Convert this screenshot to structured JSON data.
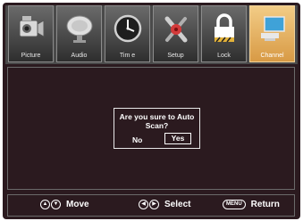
{
  "tabs": [
    {
      "label": "Picture",
      "icon": "camcorder-icon",
      "active": false
    },
    {
      "label": "Audio",
      "icon": "satellite-dish-icon",
      "active": false
    },
    {
      "label": "Tim e",
      "icon": "clock-icon",
      "active": false
    },
    {
      "label": "Setup",
      "icon": "tools-icon",
      "active": false
    },
    {
      "label": "Lock",
      "icon": "padlock-icon",
      "active": false
    },
    {
      "label": "Channel",
      "icon": "monitor-icon",
      "active": true
    }
  ],
  "dialog": {
    "question": "Are you sure to Auto Scan?",
    "no_label": "No",
    "yes_label": "Yes",
    "selected": "Yes"
  },
  "navbar": {
    "move_label": "Move",
    "select_label": "Select",
    "return_label": "Return",
    "menu_key_label": "MENU"
  },
  "colors": {
    "background": "#2b1a1f",
    "active_tab": "#e0a555",
    "text": "#ffffff"
  }
}
